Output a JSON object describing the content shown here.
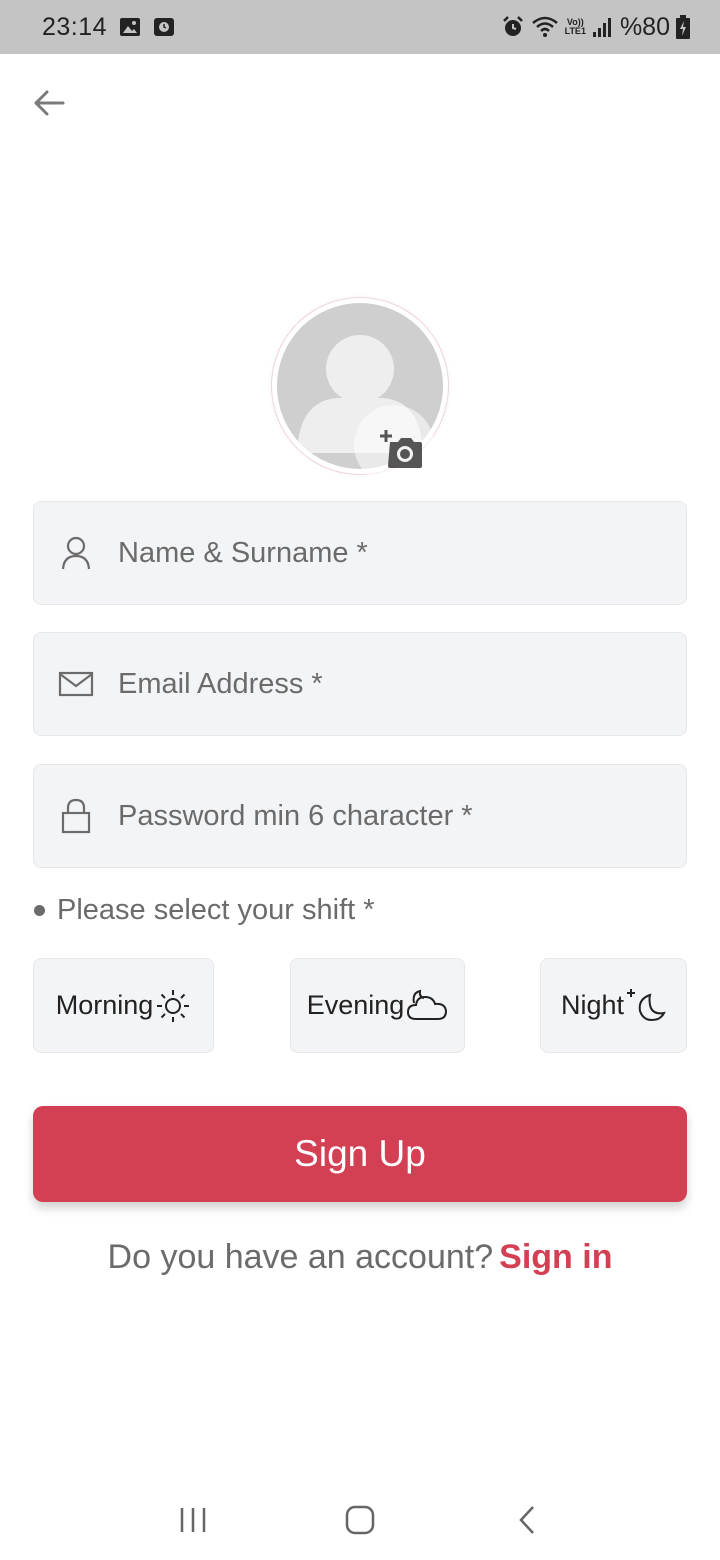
{
  "status_bar": {
    "time": "23:14",
    "network_top": "Vo))",
    "network_bottom": "LTE1",
    "battery": "%80"
  },
  "form": {
    "name_placeholder": "Name & Surname *",
    "email_placeholder": "Email Address *",
    "password_placeholder": "Password min 6 character *",
    "shift_label": "Please select your shift *",
    "shifts": [
      {
        "label": "Morning",
        "icon": "sun-icon"
      },
      {
        "label": "Evening",
        "icon": "cloud-icon"
      },
      {
        "label": "Night",
        "icon": "moon-icon"
      }
    ],
    "signup_label": "Sign Up",
    "account_question": "Do you have an account?",
    "signin_label": "Sign in"
  },
  "colors": {
    "accent": "#d33f53",
    "field_bg": "#f3f4f6",
    "text_muted": "#6b6b6b"
  }
}
